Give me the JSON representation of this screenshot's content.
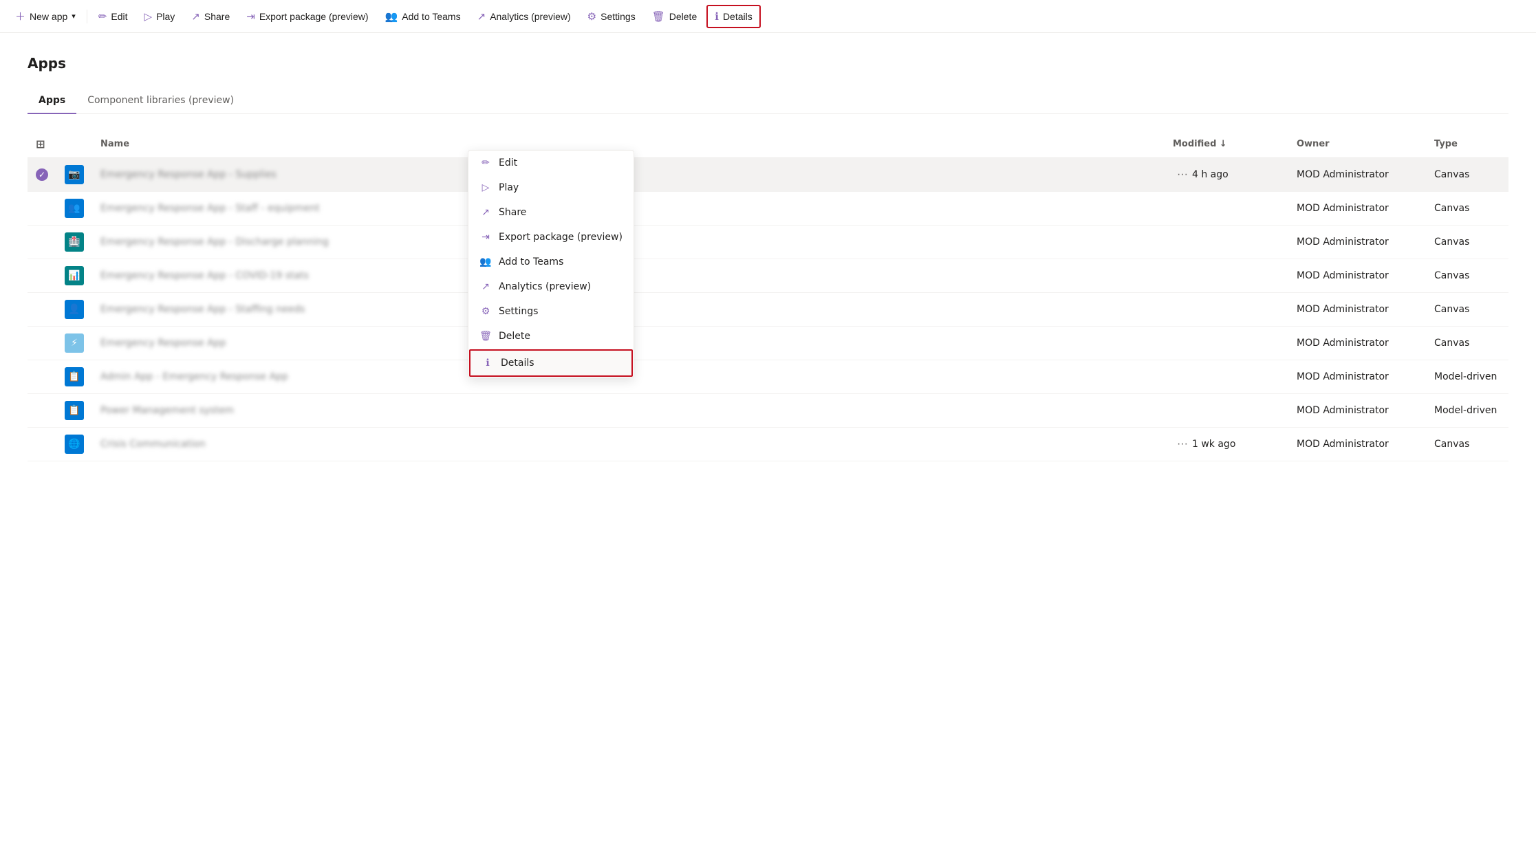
{
  "toolbar": {
    "new_app_label": "New app",
    "edit_label": "Edit",
    "play_label": "Play",
    "share_label": "Share",
    "export_label": "Export package (preview)",
    "add_to_teams_label": "Add to Teams",
    "analytics_label": "Analytics (preview)",
    "settings_label": "Settings",
    "delete_label": "Delete",
    "details_label": "Details"
  },
  "page": {
    "title": "Apps",
    "tabs": [
      {
        "label": "Apps",
        "active": true
      },
      {
        "label": "Component libraries (preview)",
        "active": false
      }
    ]
  },
  "table": {
    "columns": [
      "Name",
      "Modified ↓",
      "Owner",
      "Type"
    ],
    "rows": [
      {
        "id": 1,
        "selected": true,
        "icon_type": "blue",
        "icon": "📷",
        "name": "Emergency Response App - Supplies",
        "modified": "4 h ago",
        "owner": "MOD Administrator",
        "type": "Canvas",
        "has_more": true
      },
      {
        "id": 2,
        "selected": false,
        "icon_type": "blue",
        "icon": "👥",
        "name": "Emergency Response App - Staff - equipment",
        "modified": "",
        "owner": "MOD Administrator",
        "type": "Canvas",
        "has_more": false
      },
      {
        "id": 3,
        "selected": false,
        "icon_type": "blue",
        "icon": "🏥",
        "name": "Emergency Response App - Discharge planning",
        "modified": "",
        "owner": "MOD Administrator",
        "type": "Canvas",
        "has_more": false
      },
      {
        "id": 4,
        "selected": false,
        "icon_type": "blue",
        "icon": "📊",
        "name": "Emergency Response App - COVID-19 stats",
        "modified": "",
        "owner": "MOD Administrator",
        "type": "Canvas",
        "has_more": false
      },
      {
        "id": 5,
        "selected": false,
        "icon_type": "blue",
        "icon": "👤",
        "name": "Emergency Response App - Staffing needs",
        "modified": "",
        "owner": "MOD Administrator",
        "type": "Canvas",
        "has_more": false
      },
      {
        "id": 6,
        "selected": false,
        "icon_type": "teal",
        "icon": "⚡",
        "name": "Emergency Response App",
        "modified": "",
        "owner": "MOD Administrator",
        "type": "Canvas",
        "has_more": false
      },
      {
        "id": 7,
        "selected": false,
        "icon_type": "blue",
        "icon": "📋",
        "name": "Admin App - Emergency Response App",
        "modified": "",
        "owner": "MOD Administrator",
        "type": "Model-driven",
        "has_more": false
      },
      {
        "id": 8,
        "selected": false,
        "icon_type": "blue",
        "icon": "📋",
        "name": "Power Management system",
        "modified": "",
        "owner": "MOD Administrator",
        "type": "Model-driven",
        "has_more": false
      },
      {
        "id": 9,
        "selected": false,
        "icon_type": "globe",
        "icon": "🌐",
        "name": "Crisis Communication",
        "modified": "1 wk ago",
        "owner": "MOD Administrator",
        "type": "Canvas",
        "has_more": true
      }
    ]
  },
  "context_menu": {
    "items": [
      {
        "label": "Edit",
        "icon": "✏️",
        "highlighted": false
      },
      {
        "label": "Play",
        "icon": "▷",
        "highlighted": false
      },
      {
        "label": "Share",
        "icon": "↗",
        "highlighted": false
      },
      {
        "label": "Export package (preview)",
        "icon": "⇥",
        "highlighted": false
      },
      {
        "label": "Add to Teams",
        "icon": "👥",
        "highlighted": false
      },
      {
        "label": "Analytics (preview)",
        "icon": "↗",
        "highlighted": false
      },
      {
        "label": "Settings",
        "icon": "⚙",
        "highlighted": false
      },
      {
        "label": "Delete",
        "icon": "🗑",
        "highlighted": false
      },
      {
        "label": "Details",
        "icon": "ℹ",
        "highlighted": true
      }
    ]
  },
  "colors": {
    "accent": "#8764b8",
    "danger": "#c50f1f",
    "blue": "#0078d4"
  }
}
